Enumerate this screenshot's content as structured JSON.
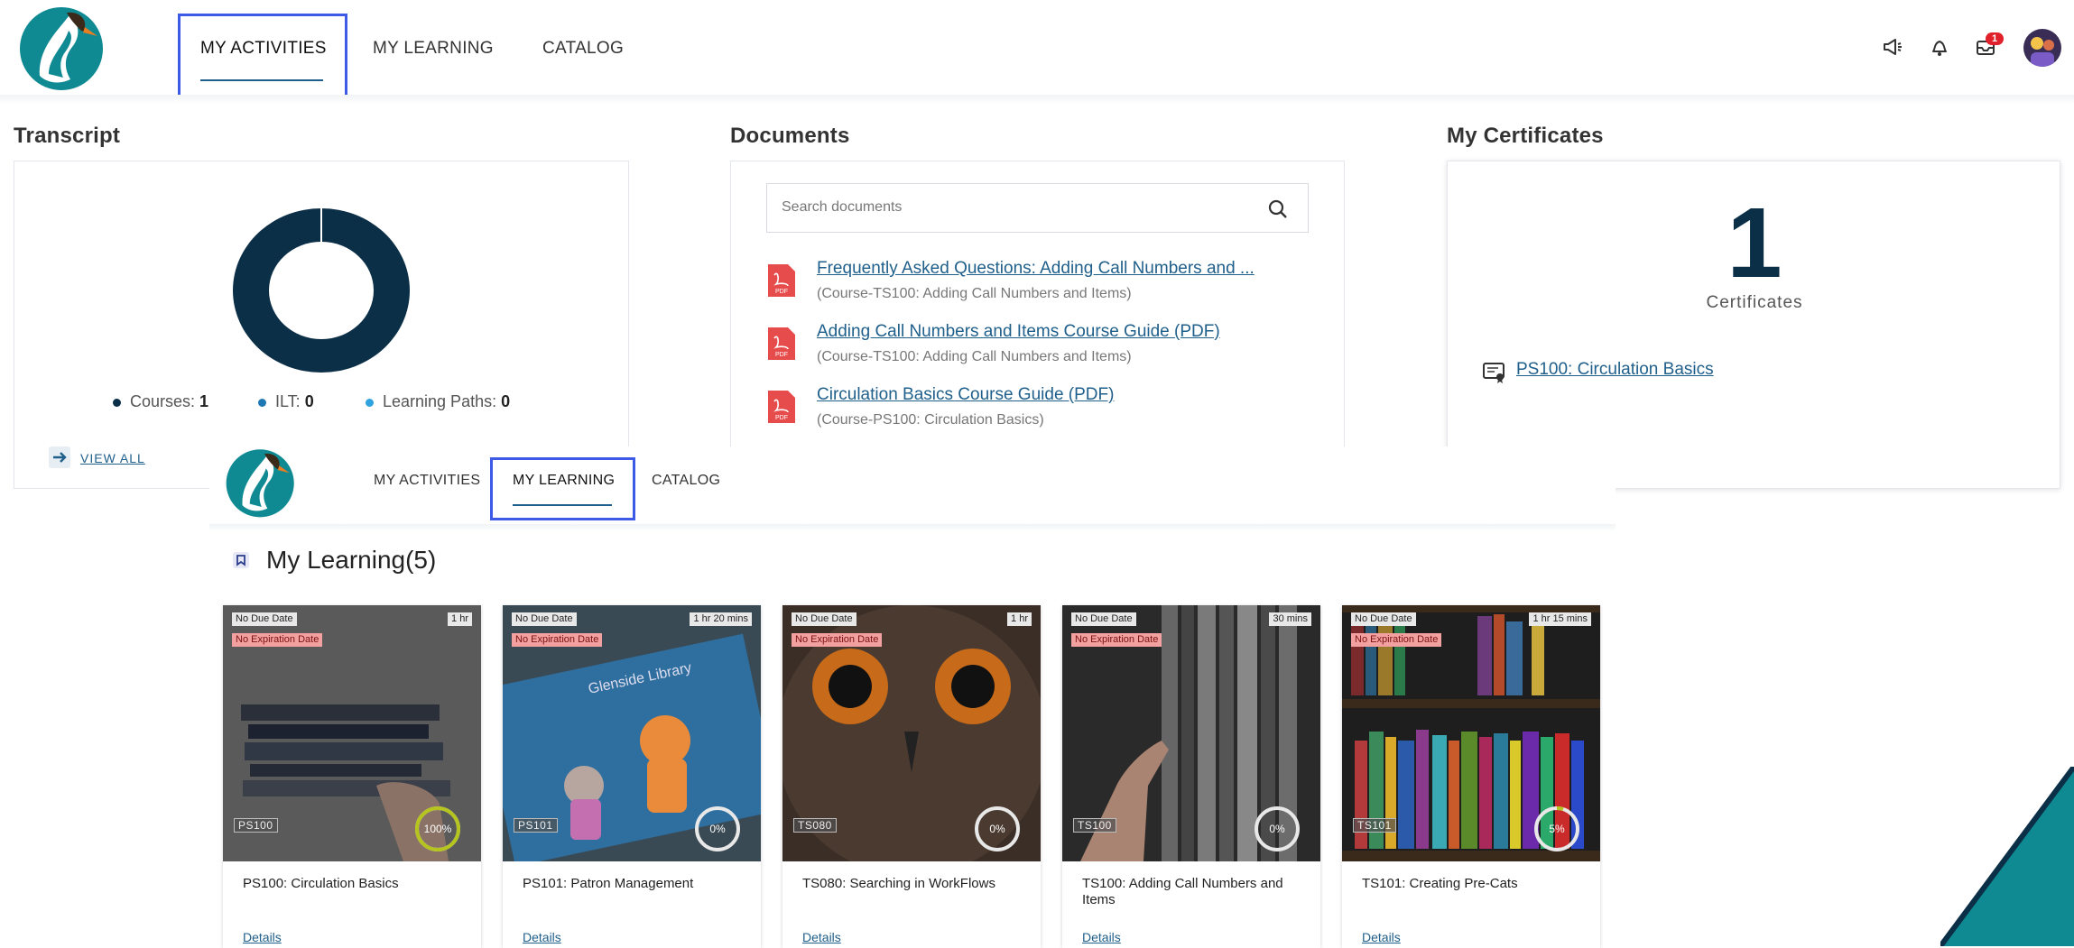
{
  "nav": {
    "items": [
      "MY ACTIVITIES",
      "MY LEARNING",
      "CATALOG"
    ],
    "notification_count": "1"
  },
  "transcript": {
    "title": "Transcript",
    "legend": [
      {
        "label": "Courses:",
        "value": "1",
        "color": "#0b2f47"
      },
      {
        "label": "ILT:",
        "value": "0",
        "color": "#1f78b4"
      },
      {
        "label": "Learning Paths:",
        "value": "0",
        "color": "#2ea3e0"
      }
    ],
    "donut_color": "#0b2f47",
    "view_all": "VIEW ALL"
  },
  "documents": {
    "title": "Documents",
    "search_placeholder": "Search documents",
    "items": [
      {
        "title": "Frequently Asked Questions: Adding Call Numbers and ...",
        "course": "(Course-TS100: Adding Call Numbers and Items)"
      },
      {
        "title": "Adding Call Numbers and Items Course Guide (PDF)",
        "course": "(Course-TS100: Adding Call Numbers and Items)"
      },
      {
        "title": "Circulation Basics Course Guide (PDF)",
        "course": "(Course-PS100: Circulation Basics)"
      }
    ],
    "pdf_badge": "PDF"
  },
  "certificates": {
    "title": "My Certificates",
    "count": "1",
    "label": "Certificates",
    "items": [
      " PS100: Circulation Basics"
    ]
  },
  "my_learning": {
    "nav_items": [
      "MY ACTIVITIES",
      "MY LEARNING",
      "CATALOG"
    ],
    "title": "My Learning(5)",
    "courses": [
      {
        "due": "No Due Date",
        "duration": "1 hr",
        "expiration": "No Expiration Date",
        "code": "PS100",
        "progress": "100%",
        "progress_value": 100,
        "title": "PS100: Circulation Basics",
        "details": "Details"
      },
      {
        "due": "No Due Date",
        "duration": "1 hr 20 mins",
        "expiration": "No Expiration Date",
        "code": "PS101",
        "progress": "0%",
        "progress_value": 0,
        "title": "PS101: Patron Management",
        "details": "Details",
        "thumb_text": "Glenside Library"
      },
      {
        "due": "No Due Date",
        "duration": "1 hr",
        "expiration": "No Expiration Date",
        "code": "TS080",
        "progress": "0%",
        "progress_value": 0,
        "title": "TS080: Searching in WorkFlows",
        "details": "Details"
      },
      {
        "due": "No Due Date",
        "duration": "30 mins",
        "expiration": "No Expiration Date",
        "code": "TS100",
        "progress": "0%",
        "progress_value": 0,
        "title": "TS100: Adding Call Numbers and Items",
        "details": "Details"
      },
      {
        "due": "No Due Date",
        "duration": "1 hr 15 mins",
        "expiration": "No Expiration Date",
        "code": "TS101",
        "progress": "5%",
        "progress_value": 5,
        "title": "TS101: Creating Pre-Cats",
        "details": "Details"
      }
    ]
  },
  "colors": {
    "brand_teal": "#0f8a93",
    "navy": "#0b2f47",
    "link": "#1f5f8b",
    "focus": "#3d5ae6"
  },
  "icons": [
    "logo-swan-icon",
    "megaphone-icon",
    "bell-icon",
    "inbox-icon",
    "avatar",
    "search-icon",
    "pdf-icon",
    "arrow-right-icon",
    "certificate-icon",
    "book-icon"
  ]
}
